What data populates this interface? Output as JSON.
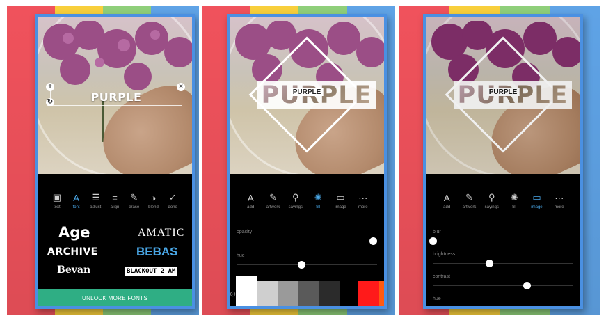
{
  "panels": [
    {
      "stripes": [
        "#f0525c",
        "#f8cf3c",
        "#8fcf7a",
        "#5fa3e6"
      ],
      "tools": [
        {
          "label": "text",
          "icon": "text-box-icon",
          "glyph": "▣",
          "active": false
        },
        {
          "label": "font",
          "icon": "font-icon",
          "glyph": "A",
          "active": true
        },
        {
          "label": "adjust",
          "icon": "sliders-icon",
          "glyph": "☰",
          "active": false
        },
        {
          "label": "align",
          "icon": "align-icon",
          "glyph": "≡",
          "active": false
        },
        {
          "label": "erase",
          "icon": "eraser-icon",
          "glyph": "✎",
          "active": false
        },
        {
          "label": "blend",
          "icon": "blend-icon",
          "glyph": "◑",
          "active": false
        },
        {
          "label": "done",
          "icon": "check-icon",
          "glyph": "✓",
          "active": false
        }
      ],
      "overlay_text": "PURPLE",
      "fonts": [
        "Age",
        "AMATIC",
        "ARCHIVE",
        "BEBAS",
        "Bevan",
        "BLACKOUT 2 AM"
      ],
      "unlock_label": "UNLOCK MORE FONTS"
    },
    {
      "stripes": [
        "#f0525c",
        "#f8cf3c",
        "#8fcf7a",
        "#5fa3e6"
      ],
      "tools": [
        {
          "label": "add",
          "icon": "font-icon",
          "glyph": "A",
          "active": false
        },
        {
          "label": "artwork",
          "icon": "pen-icon",
          "glyph": "✎",
          "active": false
        },
        {
          "label": "sayings",
          "icon": "magic-wand-icon",
          "glyph": "⚲",
          "active": false
        },
        {
          "label": "fill",
          "icon": "fill-icon",
          "glyph": "✺",
          "active": true
        },
        {
          "label": "image",
          "icon": "image-icon",
          "glyph": "▭",
          "active": false
        },
        {
          "label": "more",
          "icon": "more-icon",
          "glyph": "···",
          "active": false
        }
      ],
      "big_word": "PURPLE",
      "small_word": "PURPLE",
      "sliders": [
        {
          "name": "opacity",
          "value": 0.97
        },
        {
          "name": "hue",
          "value": 0.46
        }
      ],
      "swatch_icon": "palette-icon",
      "swatches": [
        "#ffffff",
        "#cfcfcf",
        "#9a9a9a",
        "#5a5a5a",
        "#2b2b2b",
        "#000000",
        "#ff1a1a",
        "#ff5a10"
      ]
    },
    {
      "stripes": [
        "#f0525c",
        "#f8cf3c",
        "#8fcf7a",
        "#5fa3e6"
      ],
      "tools": [
        {
          "label": "add",
          "icon": "font-icon",
          "glyph": "A",
          "active": false
        },
        {
          "label": "artwork",
          "icon": "pen-icon",
          "glyph": "✎",
          "active": false
        },
        {
          "label": "sayings",
          "icon": "magic-wand-icon",
          "glyph": "⚲",
          "active": false
        },
        {
          "label": "fill",
          "icon": "fill-icon",
          "glyph": "✺",
          "active": false
        },
        {
          "label": "image",
          "icon": "image-icon",
          "glyph": "▭",
          "active": true
        },
        {
          "label": "more",
          "icon": "more-icon",
          "glyph": "···",
          "active": false
        }
      ],
      "big_word": "PURPLE",
      "small_word": "PURPLE",
      "sliders": [
        {
          "name": "blur",
          "value": 0.0
        },
        {
          "name": "brightness",
          "value": 0.4
        },
        {
          "name": "contrast",
          "value": 0.67
        },
        {
          "name": "hue",
          "value": null
        }
      ]
    }
  ]
}
